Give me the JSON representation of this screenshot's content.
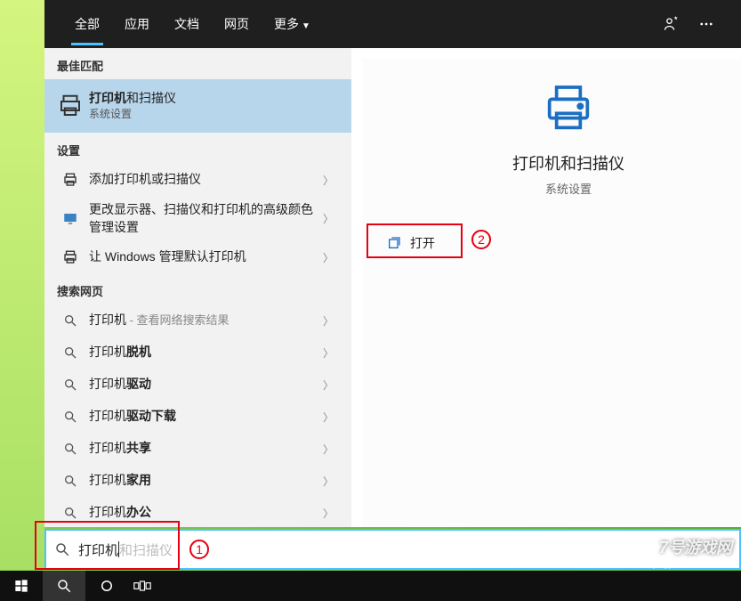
{
  "tabs": {
    "items": [
      {
        "label": "全部",
        "active": true
      },
      {
        "label": "应用",
        "active": false
      },
      {
        "label": "文档",
        "active": false
      },
      {
        "label": "网页",
        "active": false
      },
      {
        "label": "更多",
        "active": false,
        "dropdown": true
      }
    ]
  },
  "sections": {
    "best_match": "最佳匹配",
    "settings": "设置",
    "search_web": "搜索网页"
  },
  "best_match_item": {
    "title_prefix": "打印机",
    "title_rest": "和扫描仪",
    "subtitle": "系统设置"
  },
  "settings_items": [
    {
      "label": "添加打印机或扫描仪"
    },
    {
      "label": "更改显示器、扫描仪和打印机的高级颜色管理设置"
    },
    {
      "label": "让 Windows 管理默认打印机"
    }
  ],
  "web_items": [
    {
      "prefix": "打印机",
      "bold": "",
      "secondary": " - 查看网络搜索结果"
    },
    {
      "prefix": "打印机",
      "bold": "脱机",
      "secondary": ""
    },
    {
      "prefix": "打印机",
      "bold": "驱动",
      "secondary": ""
    },
    {
      "prefix": "打印机",
      "bold": "驱动下载",
      "secondary": ""
    },
    {
      "prefix": "打印机",
      "bold": "共享",
      "secondary": ""
    },
    {
      "prefix": "打印机",
      "bold": "家用",
      "secondary": ""
    },
    {
      "prefix": "打印机",
      "bold": "办公",
      "secondary": ""
    }
  ],
  "preview": {
    "title": "打印机和扫描仪",
    "subtitle": "系统设置",
    "open_label": "打开"
  },
  "search": {
    "typed": "打印机",
    "ghost": "和扫描仪"
  },
  "annotations": {
    "n1": "1",
    "n2": "2"
  },
  "watermark": {
    "line1": "7号游戏网",
    "line2": "jingyan.baidu.com"
  }
}
